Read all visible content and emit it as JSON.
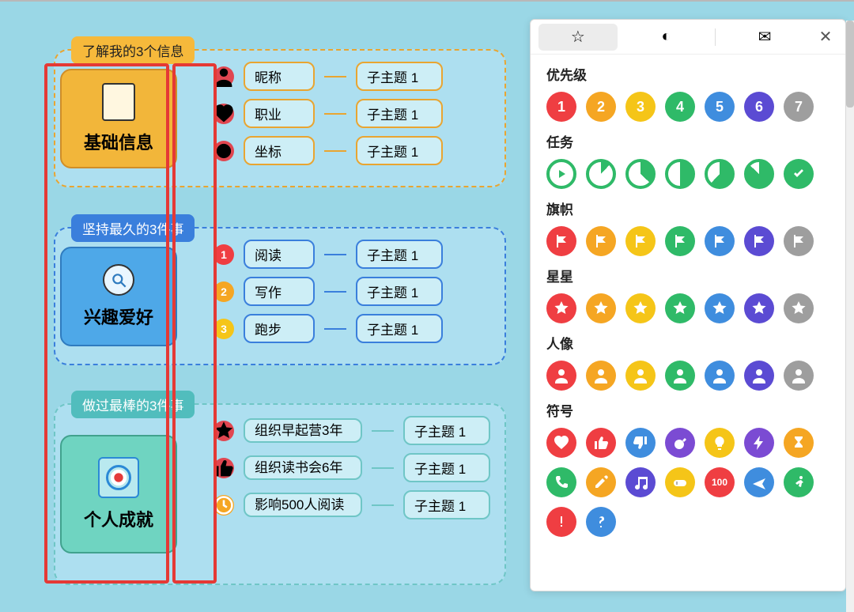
{
  "sections": [
    {
      "label": "了解我的3个信息",
      "main": "基础信息",
      "badge_style": "symbol",
      "badges": [
        {
          "color": "#e04650",
          "glyph": "person"
        },
        {
          "color": "#e04650",
          "glyph": "heart"
        },
        {
          "color": "#e04650",
          "glyph": "pin"
        }
      ],
      "items": [
        {
          "label": "昵称",
          "sub": "子主题 1"
        },
        {
          "label": "职业",
          "sub": "子主题 1"
        },
        {
          "label": "坐标",
          "sub": "子主题 1"
        }
      ]
    },
    {
      "label": "坚持最久的3件事",
      "main": "兴趣爱好",
      "badge_style": "number",
      "badges": [
        {
          "color": "#ef3e42",
          "text": "1"
        },
        {
          "color": "#f5a623",
          "text": "2"
        },
        {
          "color": "#f5c518",
          "text": "3"
        }
      ],
      "items": [
        {
          "label": "阅读",
          "sub": "子主题 1"
        },
        {
          "label": "写作",
          "sub": "子主题 1"
        },
        {
          "label": "跑步",
          "sub": "子主题 1"
        }
      ]
    },
    {
      "label": "做过最棒的3件事",
      "main": "个人成就",
      "badge_style": "symbol",
      "badges": [
        {
          "color": "#e04650",
          "glyph": "star"
        },
        {
          "color": "#e04650",
          "glyph": "thumb"
        },
        {
          "color": "#f5a623",
          "glyph": "clock"
        }
      ],
      "items": [
        {
          "label": "组织早起营3年",
          "sub": "子主题 1"
        },
        {
          "label": "组织读书会6年",
          "sub": "子主题 1"
        },
        {
          "label": "影响500人阅读",
          "sub": "子主题 1"
        }
      ]
    }
  ],
  "panel": {
    "tabs": [
      "star",
      "leaf",
      "globe"
    ],
    "groups": [
      {
        "title": "优先级",
        "items": [
          {
            "color": "#ef3e42",
            "text": "1"
          },
          {
            "color": "#f5a623",
            "text": "2"
          },
          {
            "color": "#f5c518",
            "text": "3"
          },
          {
            "color": "#2fba68",
            "text": "4"
          },
          {
            "color": "#3f8dde",
            "text": "5"
          },
          {
            "color": "#5b4bd3",
            "text": "6"
          },
          {
            "color": "#9e9e9e",
            "text": "7"
          }
        ]
      },
      {
        "title": "任务",
        "items": [
          {
            "style": "ring-play",
            "color": "#2fba68"
          },
          {
            "style": "pie",
            "color": "#2fba68",
            "pct": 12
          },
          {
            "style": "pie",
            "color": "#2fba68",
            "pct": 37
          },
          {
            "style": "pie",
            "color": "#2fba68",
            "pct": 50
          },
          {
            "style": "pie",
            "color": "#2fba68",
            "pct": 62
          },
          {
            "style": "pie",
            "color": "#2fba68",
            "pct": 87
          },
          {
            "style": "check",
            "color": "#2fba68"
          }
        ]
      },
      {
        "title": "旗帜",
        "items": [
          {
            "color": "#ef3e42",
            "glyph": "flag"
          },
          {
            "color": "#f5a623",
            "glyph": "flag"
          },
          {
            "color": "#f5c518",
            "glyph": "flag"
          },
          {
            "color": "#2fba68",
            "glyph": "flag"
          },
          {
            "color": "#3f8dde",
            "glyph": "flag"
          },
          {
            "color": "#5b4bd3",
            "glyph": "flag"
          },
          {
            "color": "#9e9e9e",
            "glyph": "flag"
          }
        ]
      },
      {
        "title": "星星",
        "items": [
          {
            "color": "#ef3e42",
            "glyph": "star"
          },
          {
            "color": "#f5a623",
            "glyph": "star"
          },
          {
            "color": "#f5c518",
            "glyph": "star"
          },
          {
            "color": "#2fba68",
            "glyph": "star"
          },
          {
            "color": "#3f8dde",
            "glyph": "star"
          },
          {
            "color": "#5b4bd3",
            "glyph": "star"
          },
          {
            "color": "#9e9e9e",
            "glyph": "star"
          }
        ]
      },
      {
        "title": "人像",
        "items": [
          {
            "color": "#ef3e42",
            "glyph": "person"
          },
          {
            "color": "#f5a623",
            "glyph": "person"
          },
          {
            "color": "#f5c518",
            "glyph": "person"
          },
          {
            "color": "#2fba68",
            "glyph": "person"
          },
          {
            "color": "#3f8dde",
            "glyph": "person"
          },
          {
            "color": "#5b4bd3",
            "glyph": "person"
          },
          {
            "color": "#9e9e9e",
            "glyph": "person"
          }
        ]
      },
      {
        "title": "符号",
        "items": [
          {
            "color": "#ef3e42",
            "glyph": "heart"
          },
          {
            "color": "#ef3e42",
            "glyph": "thumb-up"
          },
          {
            "color": "#3f8dde",
            "glyph": "thumb-down"
          },
          {
            "color": "#7b4bd3",
            "glyph": "bomb"
          },
          {
            "color": "#f5c518",
            "glyph": "bulb"
          },
          {
            "color": "#7b4bd3",
            "glyph": "bolt"
          },
          {
            "color": "#f5a623",
            "glyph": "hourglass"
          },
          {
            "color": "#2fba68",
            "glyph": "phone"
          },
          {
            "color": "#f5a623",
            "glyph": "pencil"
          },
          {
            "color": "#5b4bd3",
            "glyph": "music"
          },
          {
            "color": "#f5c518",
            "glyph": "gamepad"
          },
          {
            "color": "#ef3e42",
            "text": "100"
          },
          {
            "color": "#3f8dde",
            "glyph": "plane"
          },
          {
            "color": "#2fba68",
            "glyph": "run"
          },
          {
            "color": "#ef3e42",
            "glyph": "alert"
          },
          {
            "color": "#3f8dde",
            "glyph": "question"
          }
        ]
      }
    ]
  }
}
